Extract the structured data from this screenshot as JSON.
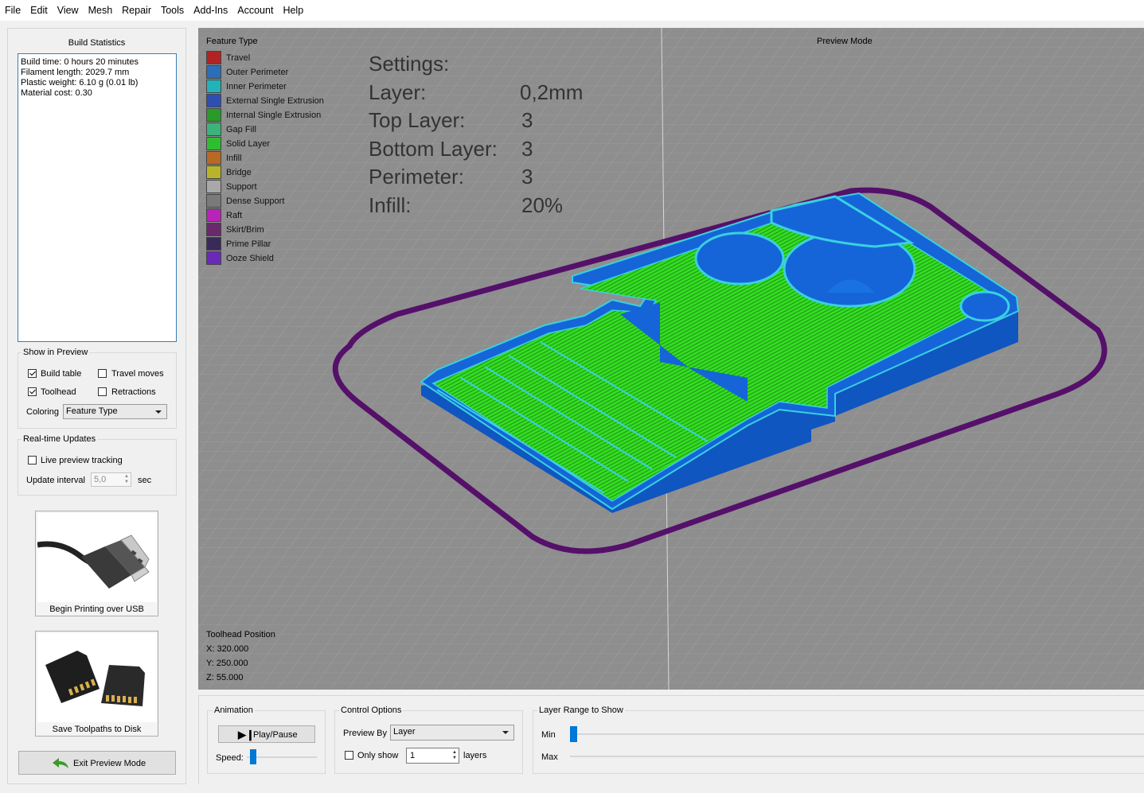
{
  "menu": [
    "File",
    "Edit",
    "View",
    "Mesh",
    "Repair",
    "Tools",
    "Add-Ins",
    "Account",
    "Help"
  ],
  "build_stats": {
    "title": "Build Statistics",
    "lines": [
      "Build time: 0 hours 20 minutes",
      "Filament length: 2029.7 mm",
      "Plastic weight: 6.10 g (0.01 lb)",
      "Material cost: 0.30"
    ]
  },
  "show_in_preview": {
    "title": "Show in Preview",
    "build_table": "Build table",
    "build_table_checked": true,
    "travel_moves": "Travel moves",
    "travel_moves_checked": false,
    "toolhead": "Toolhead",
    "toolhead_checked": true,
    "retractions": "Retractions",
    "retractions_checked": false,
    "coloring_label": "Coloring",
    "coloring_value": "Feature Type"
  },
  "realtime": {
    "title": "Real-time Updates",
    "live_label": "Live preview tracking",
    "live_checked": false,
    "interval_label": "Update interval",
    "interval_value": "5,0",
    "interval_unit": "sec"
  },
  "usb_button": "Begin Printing over USB",
  "disk_button": "Save Toolpaths to Disk",
  "exit_button": "Exit Preview Mode",
  "viewport": {
    "legend_title": "Feature Type",
    "mode_label": "Preview Mode",
    "legend": [
      {
        "label": "Travel",
        "color": "#b22424"
      },
      {
        "label": "Outer Perimeter",
        "color": "#2a6fb8"
      },
      {
        "label": "Inner Perimeter",
        "color": "#21b3b8"
      },
      {
        "label": "External Single Extrusion",
        "color": "#2d4fb3"
      },
      {
        "label": "Internal Single Extrusion",
        "color": "#2a9a2a"
      },
      {
        "label": "Gap Fill",
        "color": "#3cb37a"
      },
      {
        "label": "Solid Layer",
        "color": "#2ebd2e"
      },
      {
        "label": "Infill",
        "color": "#b86a24"
      },
      {
        "label": "Bridge",
        "color": "#b8b42a"
      },
      {
        "label": "Support",
        "color": "#a8a8a8"
      },
      {
        "label": "Dense Support",
        "color": "#7a7a7a"
      },
      {
        "label": "Raft",
        "color": "#b824b8"
      },
      {
        "label": "Skirt/Brim",
        "color": "#6a2a6a"
      },
      {
        "label": "Prime Pillar",
        "color": "#3a2a5a"
      },
      {
        "label": "Ooze Shield",
        "color": "#6a2ab8"
      }
    ],
    "settings": [
      {
        "label": "Settings:",
        "value": ""
      },
      {
        "label": "Layer:",
        "value": "0,2mm"
      },
      {
        "label": "Top Layer:",
        "value": "3"
      },
      {
        "label": "Bottom Layer:",
        "value": "3"
      },
      {
        "label": "Perimeter:",
        "value": "3"
      },
      {
        "label": "Infill:",
        "value": "20%"
      }
    ],
    "toolhead_title": "Toolhead Position",
    "toolhead_x": "X: 320.000",
    "toolhead_y": "Y: 250.000",
    "toolhead_z": "Z: 55.000"
  },
  "animation": {
    "title": "Animation",
    "play_label": "Play/Pause",
    "speed_label": "Speed:",
    "speed_level": 0.05
  },
  "control": {
    "title": "Control Options",
    "preview_by_label": "Preview By",
    "preview_by_value": "Layer",
    "only_show_label": "Only show",
    "only_show_checked": false,
    "layers_value": "1",
    "layers_unit": "layers"
  },
  "layer_range": {
    "title": "Layer Range to Show",
    "min_label": "Min",
    "max_label": "Max"
  },
  "colors": {
    "skirt": "#55106a",
    "part_blue": "#1565d8",
    "part_cyan": "#3ad0e0",
    "infill_green": "#33dd22"
  }
}
